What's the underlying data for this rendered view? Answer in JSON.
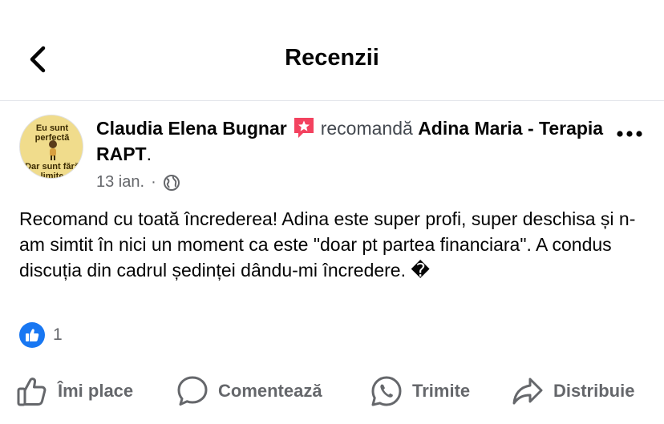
{
  "header": {
    "title": "Recenzii"
  },
  "post": {
    "author": "Claudia Elena Bugnar",
    "verb": "recomandă",
    "page_name": "Adina Maria - Terapia RAPT",
    "period": ".",
    "date": "13 ian.",
    "separator": "·",
    "avatar_top_text": "Eu sunt perfectă",
    "avatar_bottom_text": "Dar sunt fără limite",
    "body": "Recomand cu toată încrederea!  Adina este super profi, super deschisa și n-am simtit în nici un moment ca este \"doar pt partea financiara\". A condus discuția din cadrul ședinței dându-mi încredere. �",
    "reaction_count": "1"
  },
  "actions": {
    "like": "Îmi place",
    "comment": "Comentează",
    "send": "Trimite",
    "share": "Distribuie"
  },
  "colors": {
    "accent": "#1877f2",
    "recommend_badge": "#f3425f",
    "secondary_text": "#65676b"
  },
  "icons": {
    "back": "chevron-left-icon",
    "badge": "star-badge-icon",
    "more": "more-dots-icon",
    "privacy": "globe-icon",
    "reaction": "like-thumb-icon",
    "like": "thumbs-up-outline-icon",
    "comment": "comment-bubble-icon",
    "send": "whatsapp-icon",
    "share": "share-arrow-icon"
  }
}
